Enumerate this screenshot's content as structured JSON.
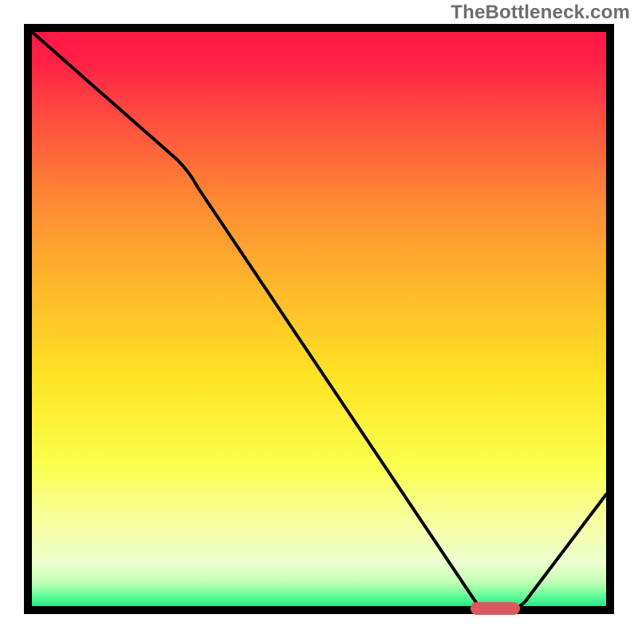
{
  "watermark": "TheBottleneck.com",
  "chart_data": {
    "type": "line",
    "title": "",
    "xlabel": "",
    "ylabel": "",
    "xlim": [
      0,
      100
    ],
    "ylim": [
      0,
      100
    ],
    "x": [
      0,
      25,
      77,
      82,
      100
    ],
    "values": [
      100,
      78,
      0,
      0,
      20
    ],
    "marker": {
      "x_start": 76,
      "x_end": 84,
      "y": 0
    },
    "background_gradient": {
      "stops": [
        {
          "pos": 0.0,
          "color": "#ff1744"
        },
        {
          "pos": 0.05,
          "color": "#ff1e46"
        },
        {
          "pos": 0.15,
          "color": "#ff4b3f"
        },
        {
          "pos": 0.3,
          "color": "#ff8a34"
        },
        {
          "pos": 0.45,
          "color": "#ffb92b"
        },
        {
          "pos": 0.6,
          "color": "#ffe324"
        },
        {
          "pos": 0.75,
          "color": "#faff4d"
        },
        {
          "pos": 0.85,
          "color": "#f8ffa2"
        },
        {
          "pos": 0.92,
          "color": "#ecffd0"
        },
        {
          "pos": 0.95,
          "color": "#c7ffb6"
        },
        {
          "pos": 0.97,
          "color": "#7dffa0"
        },
        {
          "pos": 1.0,
          "color": "#00e680"
        }
      ]
    },
    "frame_color": "#000000",
    "curve_color": "#000000",
    "marker_color": "#d85a5f"
  }
}
